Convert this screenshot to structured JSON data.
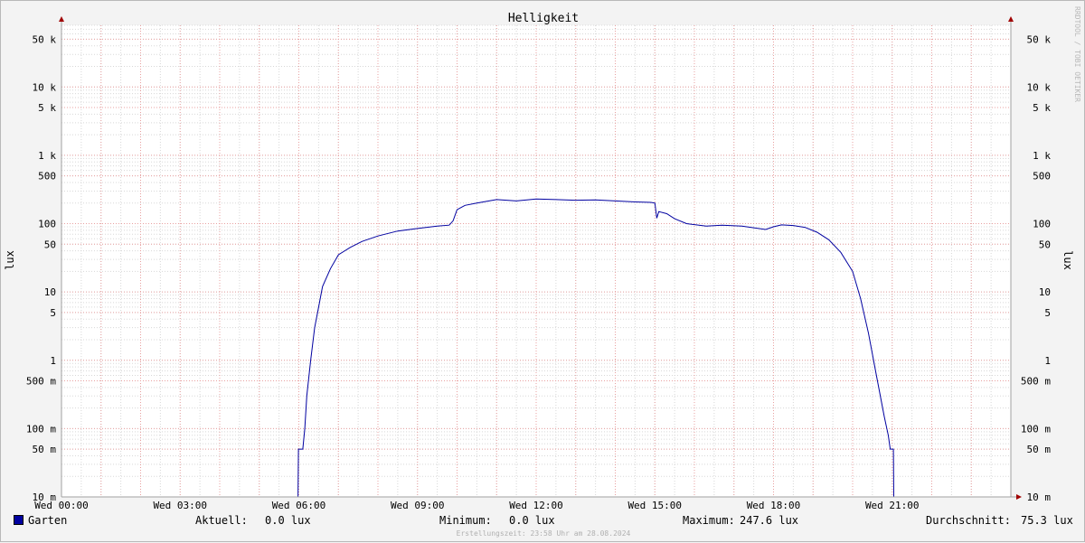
{
  "watermark": "RRDTOOL / TOBI OETIKER",
  "legend": {
    "series_name": "Garten",
    "series_color": "#0000a0",
    "current_label": "Aktuell:",
    "current_value": "0.0 lux",
    "min_label": "Minimum:",
    "min_value": "0.0 lux",
    "max_label": "Maximum:",
    "max_value": "247.6 lux",
    "avg_label": "Durchschnitt:",
    "avg_value": "75.3 lux"
  },
  "footer": "Erstellungszeit: 23:58 Uhr am 28.08.2024",
  "colors": {
    "background": "#f3f3f3",
    "canvas": "#ffffff",
    "major_grid": "#e8a0a0",
    "minor_grid": "#d8d8d8",
    "axis": "#a0a0a0",
    "arrow": "#a00000",
    "line": "#0000a0"
  },
  "chart_data": {
    "type": "line",
    "title": "Helligkeit",
    "ylabel": "lux",
    "y_scale": "log",
    "ylim": [
      0.01,
      80000
    ],
    "y_ticks": [
      {
        "value": 0.01,
        "label": "10 m"
      },
      {
        "value": 0.05,
        "label": "50 m"
      },
      {
        "value": 0.1,
        "label": "100 m"
      },
      {
        "value": 0.5,
        "label": "500 m"
      },
      {
        "value": 1,
        "label": "1"
      },
      {
        "value": 5,
        "label": "5"
      },
      {
        "value": 10,
        "label": "10"
      },
      {
        "value": 50,
        "label": "50"
      },
      {
        "value": 100,
        "label": "100"
      },
      {
        "value": 500,
        "label": "500"
      },
      {
        "value": 1000,
        "label": "1 k"
      },
      {
        "value": 5000,
        "label": "5 k"
      },
      {
        "value": 10000,
        "label": "10 k"
      },
      {
        "value": 50000,
        "label": "50 k"
      }
    ],
    "xlim": [
      0,
      24
    ],
    "x_ticks": [
      {
        "value": 0,
        "label": "Wed 00:00"
      },
      {
        "value": 3,
        "label": "Wed 03:00"
      },
      {
        "value": 6,
        "label": "Wed 06:00"
      },
      {
        "value": 9,
        "label": "Wed 09:00"
      },
      {
        "value": 12,
        "label": "Wed 12:00"
      },
      {
        "value": 15,
        "label": "Wed 15:00"
      },
      {
        "value": 18,
        "label": "Wed 18:00"
      },
      {
        "value": 21,
        "label": "Wed 21:00"
      }
    ],
    "grid": true,
    "series": [
      {
        "name": "Garten",
        "color": "#0000a0",
        "points": [
          [
            0,
            0.01
          ],
          [
            5.98,
            0.01
          ],
          [
            5.99,
            0.05
          ],
          [
            6.1,
            0.05
          ],
          [
            6.15,
            0.1
          ],
          [
            6.2,
            0.3
          ],
          [
            6.3,
            1
          ],
          [
            6.4,
            3
          ],
          [
            6.5,
            6
          ],
          [
            6.6,
            12
          ],
          [
            6.8,
            22
          ],
          [
            7.0,
            35
          ],
          [
            7.3,
            45
          ],
          [
            7.6,
            55
          ],
          [
            8.0,
            66
          ],
          [
            8.5,
            78
          ],
          [
            9.0,
            85
          ],
          [
            9.5,
            92
          ],
          [
            9.8,
            95
          ],
          [
            9.9,
            110
          ],
          [
            10.0,
            160
          ],
          [
            10.2,
            185
          ],
          [
            10.5,
            200
          ],
          [
            11.0,
            225
          ],
          [
            11.5,
            215
          ],
          [
            12.0,
            230
          ],
          [
            12.5,
            225
          ],
          [
            13.0,
            220
          ],
          [
            13.5,
            222
          ],
          [
            14.0,
            215
          ],
          [
            14.5,
            208
          ],
          [
            14.9,
            205
          ],
          [
            15.0,
            200
          ],
          [
            15.05,
            120
          ],
          [
            15.1,
            150
          ],
          [
            15.3,
            140
          ],
          [
            15.5,
            118
          ],
          [
            15.8,
            100
          ],
          [
            16.3,
            92
          ],
          [
            16.7,
            95
          ],
          [
            17.2,
            92
          ],
          [
            17.8,
            82
          ],
          [
            18.0,
            90
          ],
          [
            18.2,
            96
          ],
          [
            18.5,
            94
          ],
          [
            18.8,
            88
          ],
          [
            19.1,
            75
          ],
          [
            19.4,
            58
          ],
          [
            19.7,
            38
          ],
          [
            20.0,
            20
          ],
          [
            20.2,
            8
          ],
          [
            20.4,
            2.5
          ],
          [
            20.6,
            0.6
          ],
          [
            20.8,
            0.15
          ],
          [
            20.9,
            0.08
          ],
          [
            20.95,
            0.05
          ],
          [
            21.03,
            0.05
          ],
          [
            21.04,
            0.01
          ],
          [
            24,
            0.01
          ]
        ]
      }
    ]
  }
}
